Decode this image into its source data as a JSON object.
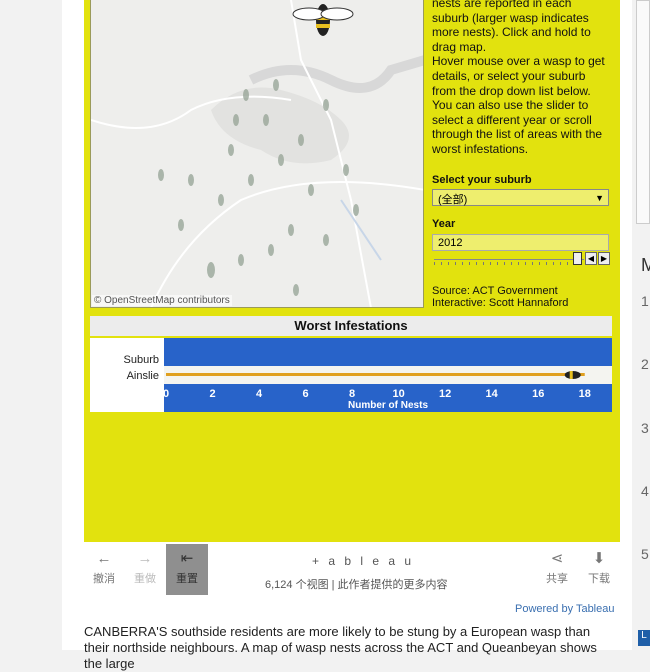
{
  "viz": {
    "info_lines": [
      "nests are reported in each",
      "suburb (larger wasp indicates",
      "more nests). Click and hold to",
      "drag map.",
      "Hover mouse over a wasp to get",
      "details, or select your suburb",
      "from the drop down list below.",
      "You can also use the slider to",
      "select a different year or scroll",
      "through the list of areas with the",
      "worst infestations."
    ],
    "suburb_label": "Select your suburb",
    "suburb_value": "(全部)",
    "year_label": "Year",
    "year_value": "2012",
    "source_line": "Source: ACT Government",
    "interactive_line": "Interactive: Scott Hannaford",
    "map_credit": "© OpenStreetMap contributors",
    "worst_title": "Worst Infestations"
  },
  "chart_data": {
    "type": "bar",
    "title": "Worst Infestations",
    "row_header": "Suburb",
    "categories": [
      "Ainslie"
    ],
    "values": [
      18
    ],
    "xlabel": "Number of Nests",
    "xlim": [
      0,
      19
    ],
    "x_ticks": [
      0,
      2,
      4,
      6,
      8,
      10,
      12,
      14,
      16,
      18
    ]
  },
  "toolbar": {
    "undo": "撤消",
    "redo": "重做",
    "reset": "重置",
    "share": "共享",
    "download": "下载",
    "tableau": "+ a b l e a u",
    "views": "6,124 个视图 | 此作者提供的更多内容",
    "powered": "Powered by Tableau"
  },
  "article": {
    "text": "CANBERRA'S southside residents are more likely to be stung by a European wasp than their northside neighbours. A map of wasp nests across the ACT and Queanbeyan shows the large"
  },
  "sidebar": {
    "letter": "M",
    "numbers": [
      "1",
      "2",
      "3",
      "4",
      "5"
    ],
    "tag": "L"
  },
  "colors": {
    "viz_bg": "#e2e20e",
    "chart_blue": "#2863c9",
    "bar": "#e0a020",
    "link": "#3a6fb0"
  }
}
